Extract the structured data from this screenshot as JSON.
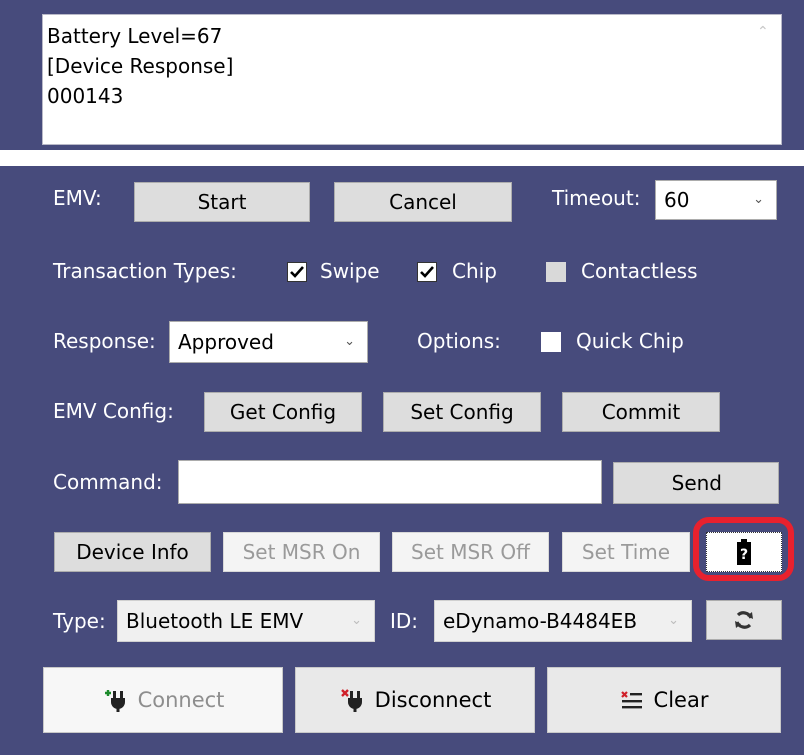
{
  "output": {
    "lines": [
      "Battery Level=67",
      "[Device Response]",
      "000143"
    ]
  },
  "emv": {
    "label": "EMV:",
    "start_label": "Start",
    "cancel_label": "Cancel",
    "timeout_label": "Timeout:",
    "timeout_value": "60"
  },
  "transaction": {
    "label": "Transaction Types:",
    "types": [
      {
        "label": "Swipe",
        "checked": true,
        "enabled": true
      },
      {
        "label": "Chip",
        "checked": true,
        "enabled": true
      },
      {
        "label": "Contactless",
        "checked": false,
        "enabled": false
      }
    ]
  },
  "response": {
    "label": "Response:",
    "value": "Approved",
    "options_label": "Options:",
    "quick_chip_label": "Quick Chip",
    "quick_chip_checked": false
  },
  "emv_config": {
    "label": "EMV Config:",
    "get_label": "Get Config",
    "set_label": "Set Config",
    "commit_label": "Commit"
  },
  "command": {
    "label": "Command:",
    "value": "",
    "send_label": "Send"
  },
  "device": {
    "info_label": "Device Info",
    "msr_on_label": "Set MSR On",
    "msr_off_label": "Set MSR Off",
    "time_label": "Set Time",
    "battery_icon": "battery-unknown-icon",
    "highlight_color": "#e8212e"
  },
  "connection": {
    "type_label": "Type:",
    "type_value": "Bluetooth LE EMV",
    "id_label": "ID:",
    "id_value": "eDynamo-B4484EB",
    "refresh_icon": "refresh-icon"
  },
  "actions": {
    "connect_label": "Connect",
    "disconnect_label": "Disconnect",
    "clear_label": "Clear"
  },
  "colors": {
    "panel": "#474b7c",
    "button": "#dddddd"
  }
}
